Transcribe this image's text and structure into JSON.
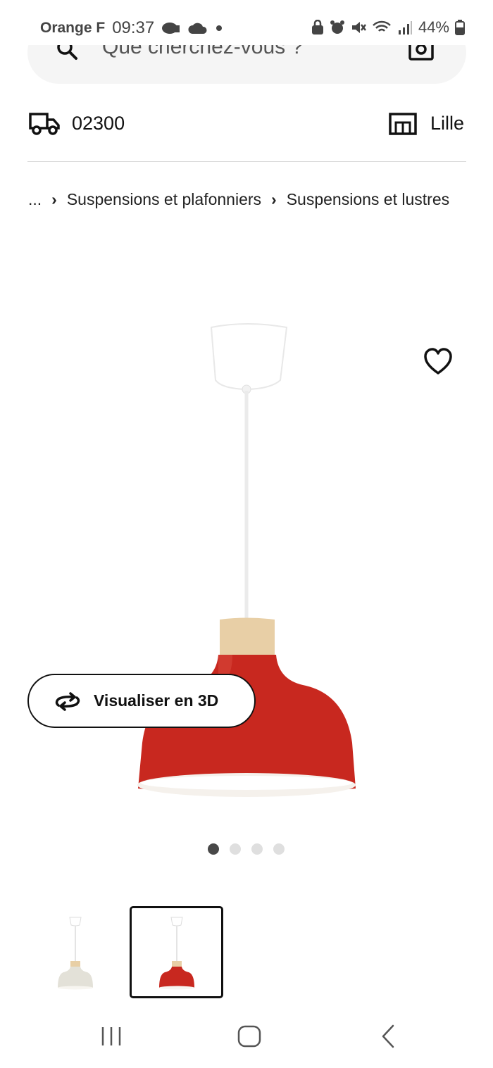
{
  "status_bar": {
    "carrier": "Orange F",
    "time": "09:37",
    "battery": "44%"
  },
  "search": {
    "placeholder": "Que cherchez-vous ?"
  },
  "delivery": {
    "postal_code": "02300"
  },
  "store": {
    "name": "Lille"
  },
  "breadcrumb": {
    "ellipsis": "...",
    "items": [
      "Suspensions et plafonniers",
      "Suspensions et lustres"
    ]
  },
  "product": {
    "view_3d_label": "Visualiser en 3D",
    "carousel": {
      "total": 4,
      "active_index": 0
    },
    "variants": [
      {
        "color_name": "beige",
        "shade_color": "#e6e4dc"
      },
      {
        "color_name": "red",
        "shade_color": "#c8281f",
        "selected": true
      }
    ]
  },
  "colors": {
    "shade_red": "#c8281f",
    "wood": "#e8cfa6",
    "canopy": "#ffffff"
  },
  "icons": {
    "search": "search-icon",
    "camera": "camera-icon",
    "truck": "truck-icon",
    "store": "store-icon",
    "favorite": "heart-icon",
    "rotate": "rotate-3d-icon"
  }
}
